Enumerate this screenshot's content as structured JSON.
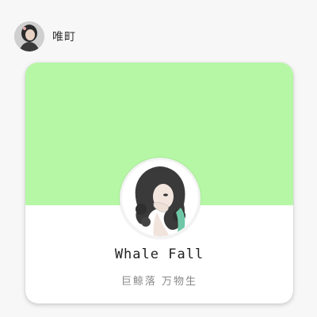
{
  "header": {
    "username": "唯町",
    "avatar_icon": "user-avatar-photo"
  },
  "card": {
    "banner_color": "#b6f7a6",
    "avatar_icon": "illustrated-girl-avatar",
    "name": "Whale  Fall",
    "bio": "巨鲸落  万物生"
  }
}
